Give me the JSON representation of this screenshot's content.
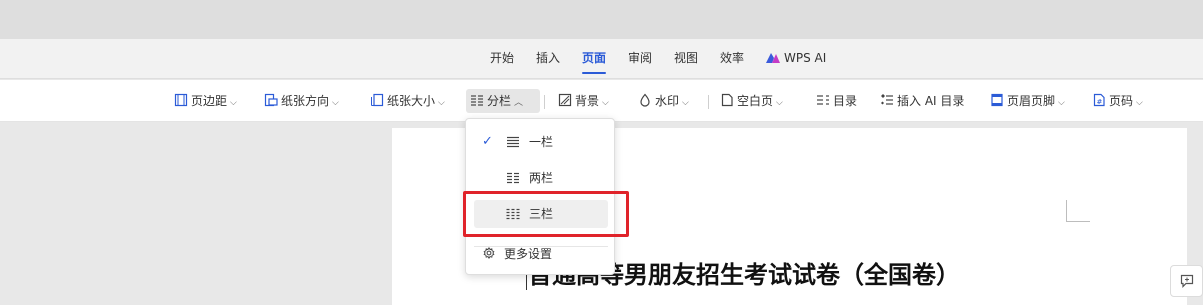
{
  "menubar": {
    "tabs": [
      {
        "label": "开始"
      },
      {
        "label": "插入"
      },
      {
        "label": "页面"
      },
      {
        "label": "审阅"
      },
      {
        "label": "视图"
      },
      {
        "label": "效率"
      },
      {
        "label": "WPS AI"
      }
    ],
    "active_tab": "页面",
    "accent_color": "#2b5bd7"
  },
  "toolbar": {
    "margins_label": "页边距",
    "orientation_label": "纸张方向",
    "size_label": "纸张大小",
    "columns_label": "分栏",
    "background_label": "背景",
    "watermark_label": "水印",
    "blank_page_label": "空白页",
    "toc_label": "目录",
    "ai_toc_label": "插入 AI 目录",
    "header_footer_label": "页眉页脚",
    "page_number_label": "页码"
  },
  "columns_menu": {
    "items": [
      {
        "label": "一栏",
        "checked": true
      },
      {
        "label": "两栏",
        "checked": false
      },
      {
        "label": "三栏",
        "checked": false
      }
    ],
    "more_settings": "更多设置",
    "highlight_color": "#e0232a"
  },
  "document": {
    "title": "普通高等男朋友招生考试试卷（全国卷）"
  },
  "icons": [
    "margins-icon",
    "orientation-icon",
    "paper-size-icon",
    "columns-icon",
    "background-icon",
    "watermark-icon",
    "blank-page-icon",
    "toc-icon",
    "ai-toc-icon",
    "header-footer-icon",
    "page-number-icon",
    "gear-icon",
    "checkmark-icon",
    "comment-icon"
  ]
}
